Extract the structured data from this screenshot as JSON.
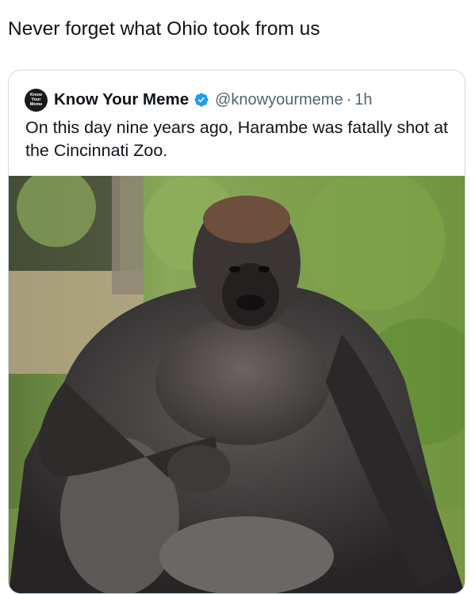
{
  "post": {
    "text": "Never forget what Ohio took from us"
  },
  "quote": {
    "avatar_lines": [
      "Know",
      "Your",
      "Meme"
    ],
    "author_name": "Know Your Meme",
    "handle": "@knowyourmeme",
    "separator": "·",
    "time": "1h",
    "text": "On this day nine years ago, Harambe was fatally shot at the Cincinnati Zoo."
  },
  "colors": {
    "verified_badge": "#1d9bf0",
    "handle_gray": "#536471",
    "card_border": "#cfd9de"
  },
  "icons": {
    "verified": "verified-badge-icon"
  }
}
